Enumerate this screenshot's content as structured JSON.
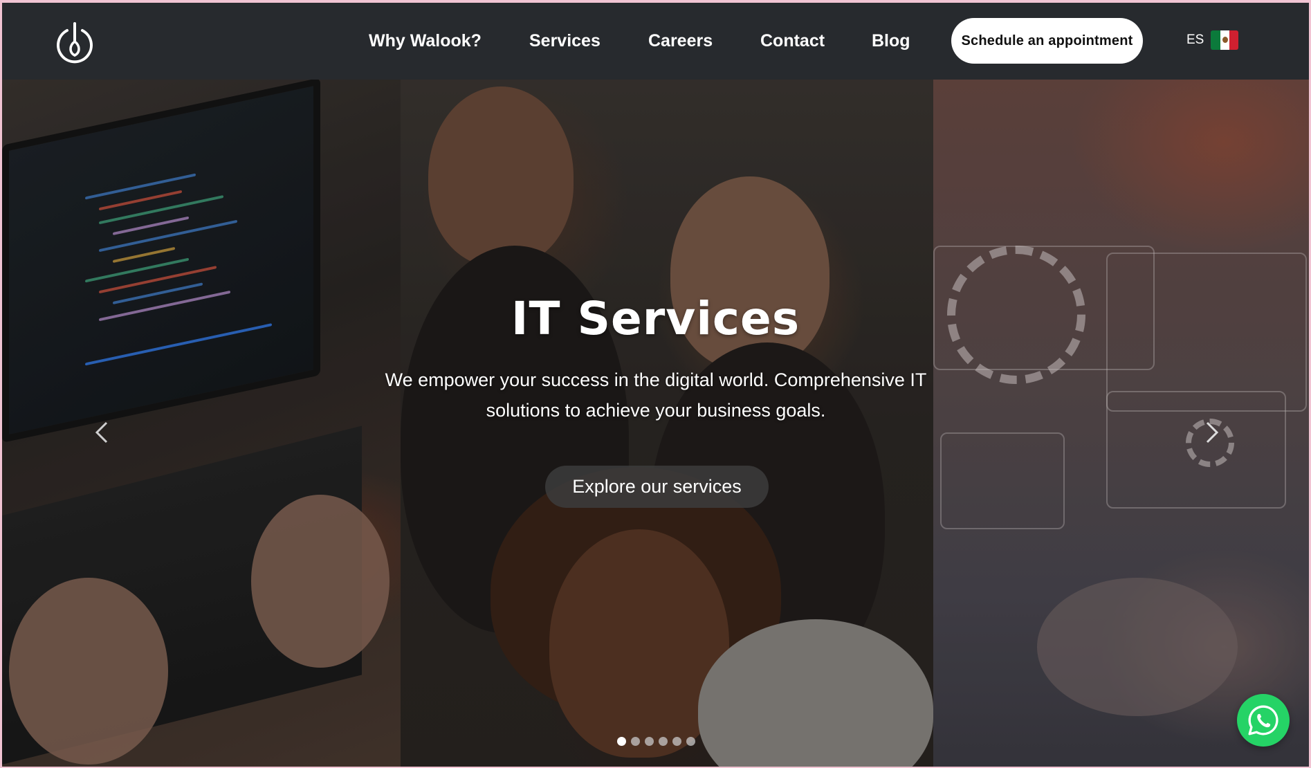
{
  "header": {
    "logo_icon": "power-leaf-logo-icon",
    "nav": [
      {
        "label": "Why Walook?"
      },
      {
        "label": "Services"
      },
      {
        "label": "Careers"
      },
      {
        "label": "Contact"
      },
      {
        "label": "Blog"
      }
    ],
    "cta_label": "Schedule an appointment",
    "language": {
      "code": "ES",
      "flag_icon": "mexico-flag-icon"
    }
  },
  "hero": {
    "title": "IT Services",
    "subtitle": "We empower your success in the digital world. Comprehensive IT solutions to achieve your business goals.",
    "cta_label": "Explore our services",
    "prev_icon": "chevron-left-icon",
    "next_icon": "chevron-right-icon",
    "slides_total": 6,
    "active_slide": 1
  },
  "whatsapp_icon": "whatsapp-icon",
  "colors": {
    "header_bg": "#272a2e",
    "cta_bg": "#ffffff",
    "whatsapp": "#25d366",
    "page_border": "#f1c4d3"
  }
}
